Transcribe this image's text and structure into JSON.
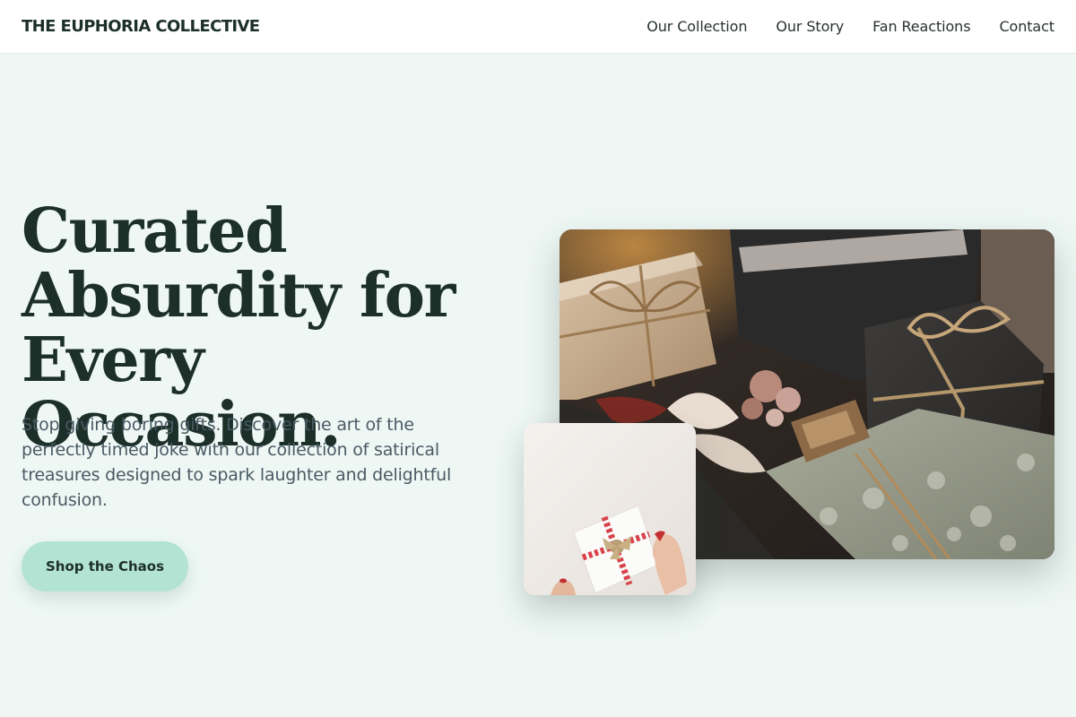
{
  "header": {
    "brand": "THE EUPHORIA COLLECTIVE",
    "nav": [
      {
        "label": "Our Collection"
      },
      {
        "label": "Our Story"
      },
      {
        "label": "Fan Reactions"
      },
      {
        "label": "Contact"
      }
    ]
  },
  "hero": {
    "title_lines": [
      "Curated",
      "Absurdity for",
      "Every Occasion."
    ],
    "description": "Stop giving boring gifts. Discover the art of the perfectly timed joke with our collection of satirical treasures designed to spark laughter and delightful confusion.",
    "cta_label": "Shop the Chaos"
  },
  "images": {
    "main": {
      "alt": "Wrapped gift boxes with twine bows"
    },
    "secondary": {
      "alt": "Hands holding a white gift with red striped ribbon"
    }
  },
  "colors": {
    "page_background": "#eef7f4",
    "header_background": "#ffffff",
    "text_dark": "#1c2f29",
    "text_muted": "#4a5a64",
    "cta_background": "#b3e3d2"
  }
}
